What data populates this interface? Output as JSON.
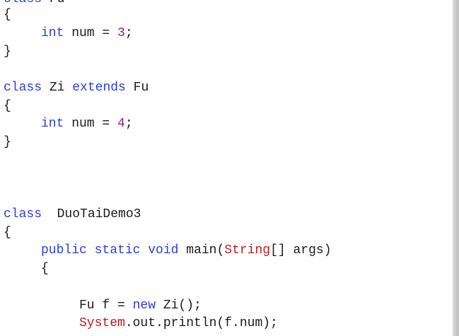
{
  "editor": {
    "lines": [
      {
        "parts": [
          {
            "t": "class",
            "c": "kw"
          },
          {
            "t": " Fu",
            "c": "txt"
          }
        ]
      },
      {
        "parts": [
          {
            "t": "{",
            "c": "txt"
          }
        ]
      },
      {
        "indent": 1,
        "parts": [
          {
            "t": "int",
            "c": "kw"
          },
          {
            "t": " num = ",
            "c": "txt"
          },
          {
            "t": "3",
            "c": "num"
          },
          {
            "t": ";",
            "c": "txt"
          }
        ]
      },
      {
        "parts": [
          {
            "t": "}",
            "c": "txt"
          }
        ]
      },
      {
        "parts": [
          {
            "t": "class",
            "c": "kw"
          },
          {
            "t": " Zi ",
            "c": "txt"
          },
          {
            "t": "extends",
            "c": "kw"
          },
          {
            "t": " Fu",
            "c": "txt"
          }
        ]
      },
      {
        "parts": [
          {
            "t": "{",
            "c": "txt"
          }
        ]
      },
      {
        "indent": 1,
        "parts": [
          {
            "t": "int",
            "c": "kw"
          },
          {
            "t": " num = ",
            "c": "txt"
          },
          {
            "t": "4",
            "c": "num"
          },
          {
            "t": ";",
            "c": "txt"
          }
        ]
      },
      {
        "parts": [
          {
            "t": "}",
            "c": "txt"
          }
        ]
      },
      {
        "parts": [
          {
            "t": "class",
            "c": "kw"
          },
          {
            "t": "  DuoTaiDemo3",
            "c": "txt"
          }
        ]
      },
      {
        "parts": [
          {
            "t": "{",
            "c": "txt"
          }
        ]
      },
      {
        "indent": 1,
        "parts": [
          {
            "t": "public",
            "c": "kw"
          },
          {
            "t": " ",
            "c": "txt"
          },
          {
            "t": "static",
            "c": "kw"
          },
          {
            "t": " ",
            "c": "txt"
          },
          {
            "t": "void",
            "c": "kw"
          },
          {
            "t": " main(",
            "c": "txt"
          },
          {
            "t": "String",
            "c": "cls"
          },
          {
            "t": "[] args)",
            "c": "txt"
          }
        ]
      },
      {
        "indent": 1,
        "parts": [
          {
            "t": "{",
            "c": "txt"
          }
        ]
      },
      {
        "indent": 2,
        "parts": [
          {
            "t": "Fu f = ",
            "c": "txt"
          },
          {
            "t": "new",
            "c": "kw"
          },
          {
            "t": " Zi();",
            "c": "txt"
          }
        ]
      },
      {
        "indent": 2,
        "parts": [
          {
            "t": "System",
            "c": "cls"
          },
          {
            "t": ".out.println(f.num);",
            "c": "txt"
          }
        ]
      }
    ]
  }
}
